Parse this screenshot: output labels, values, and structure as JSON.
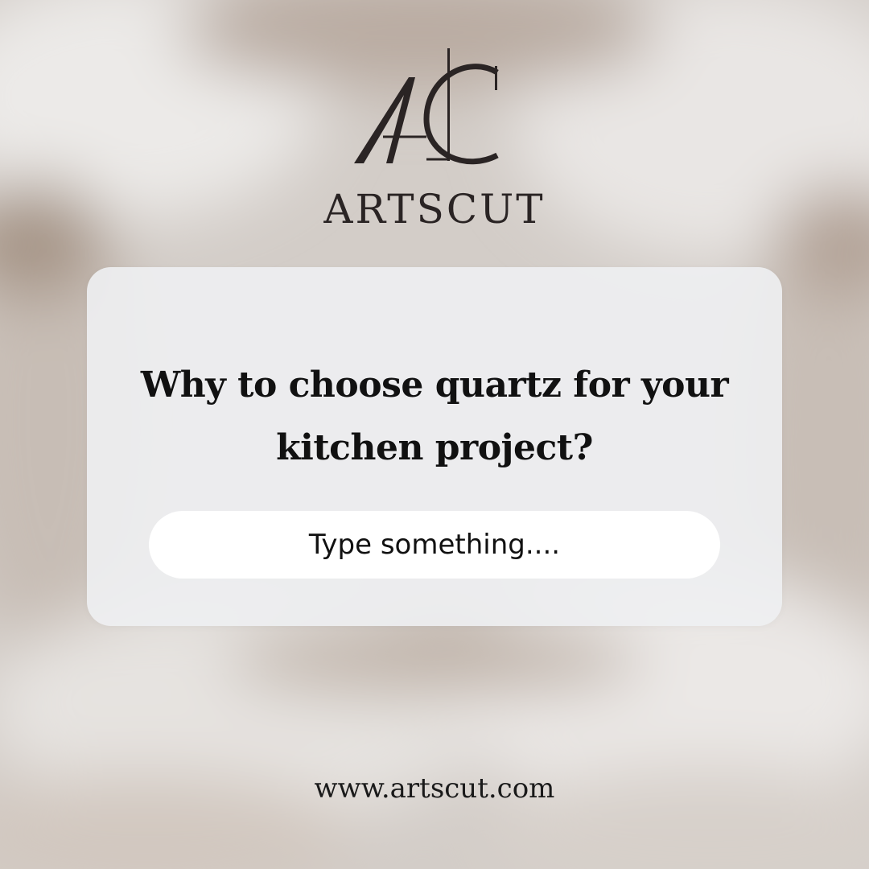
{
  "brand": {
    "monogram": "AC",
    "name": "ARTSCUT",
    "color": "#2a2424"
  },
  "card": {
    "question": "Why to choose quartz for your kitchen project?",
    "input_placeholder": "Type something...."
  },
  "footer": {
    "website": "www.artscut.com"
  },
  "colors": {
    "card_background": "#eeeff2",
    "input_background": "#ffffff",
    "text": "#111111"
  }
}
